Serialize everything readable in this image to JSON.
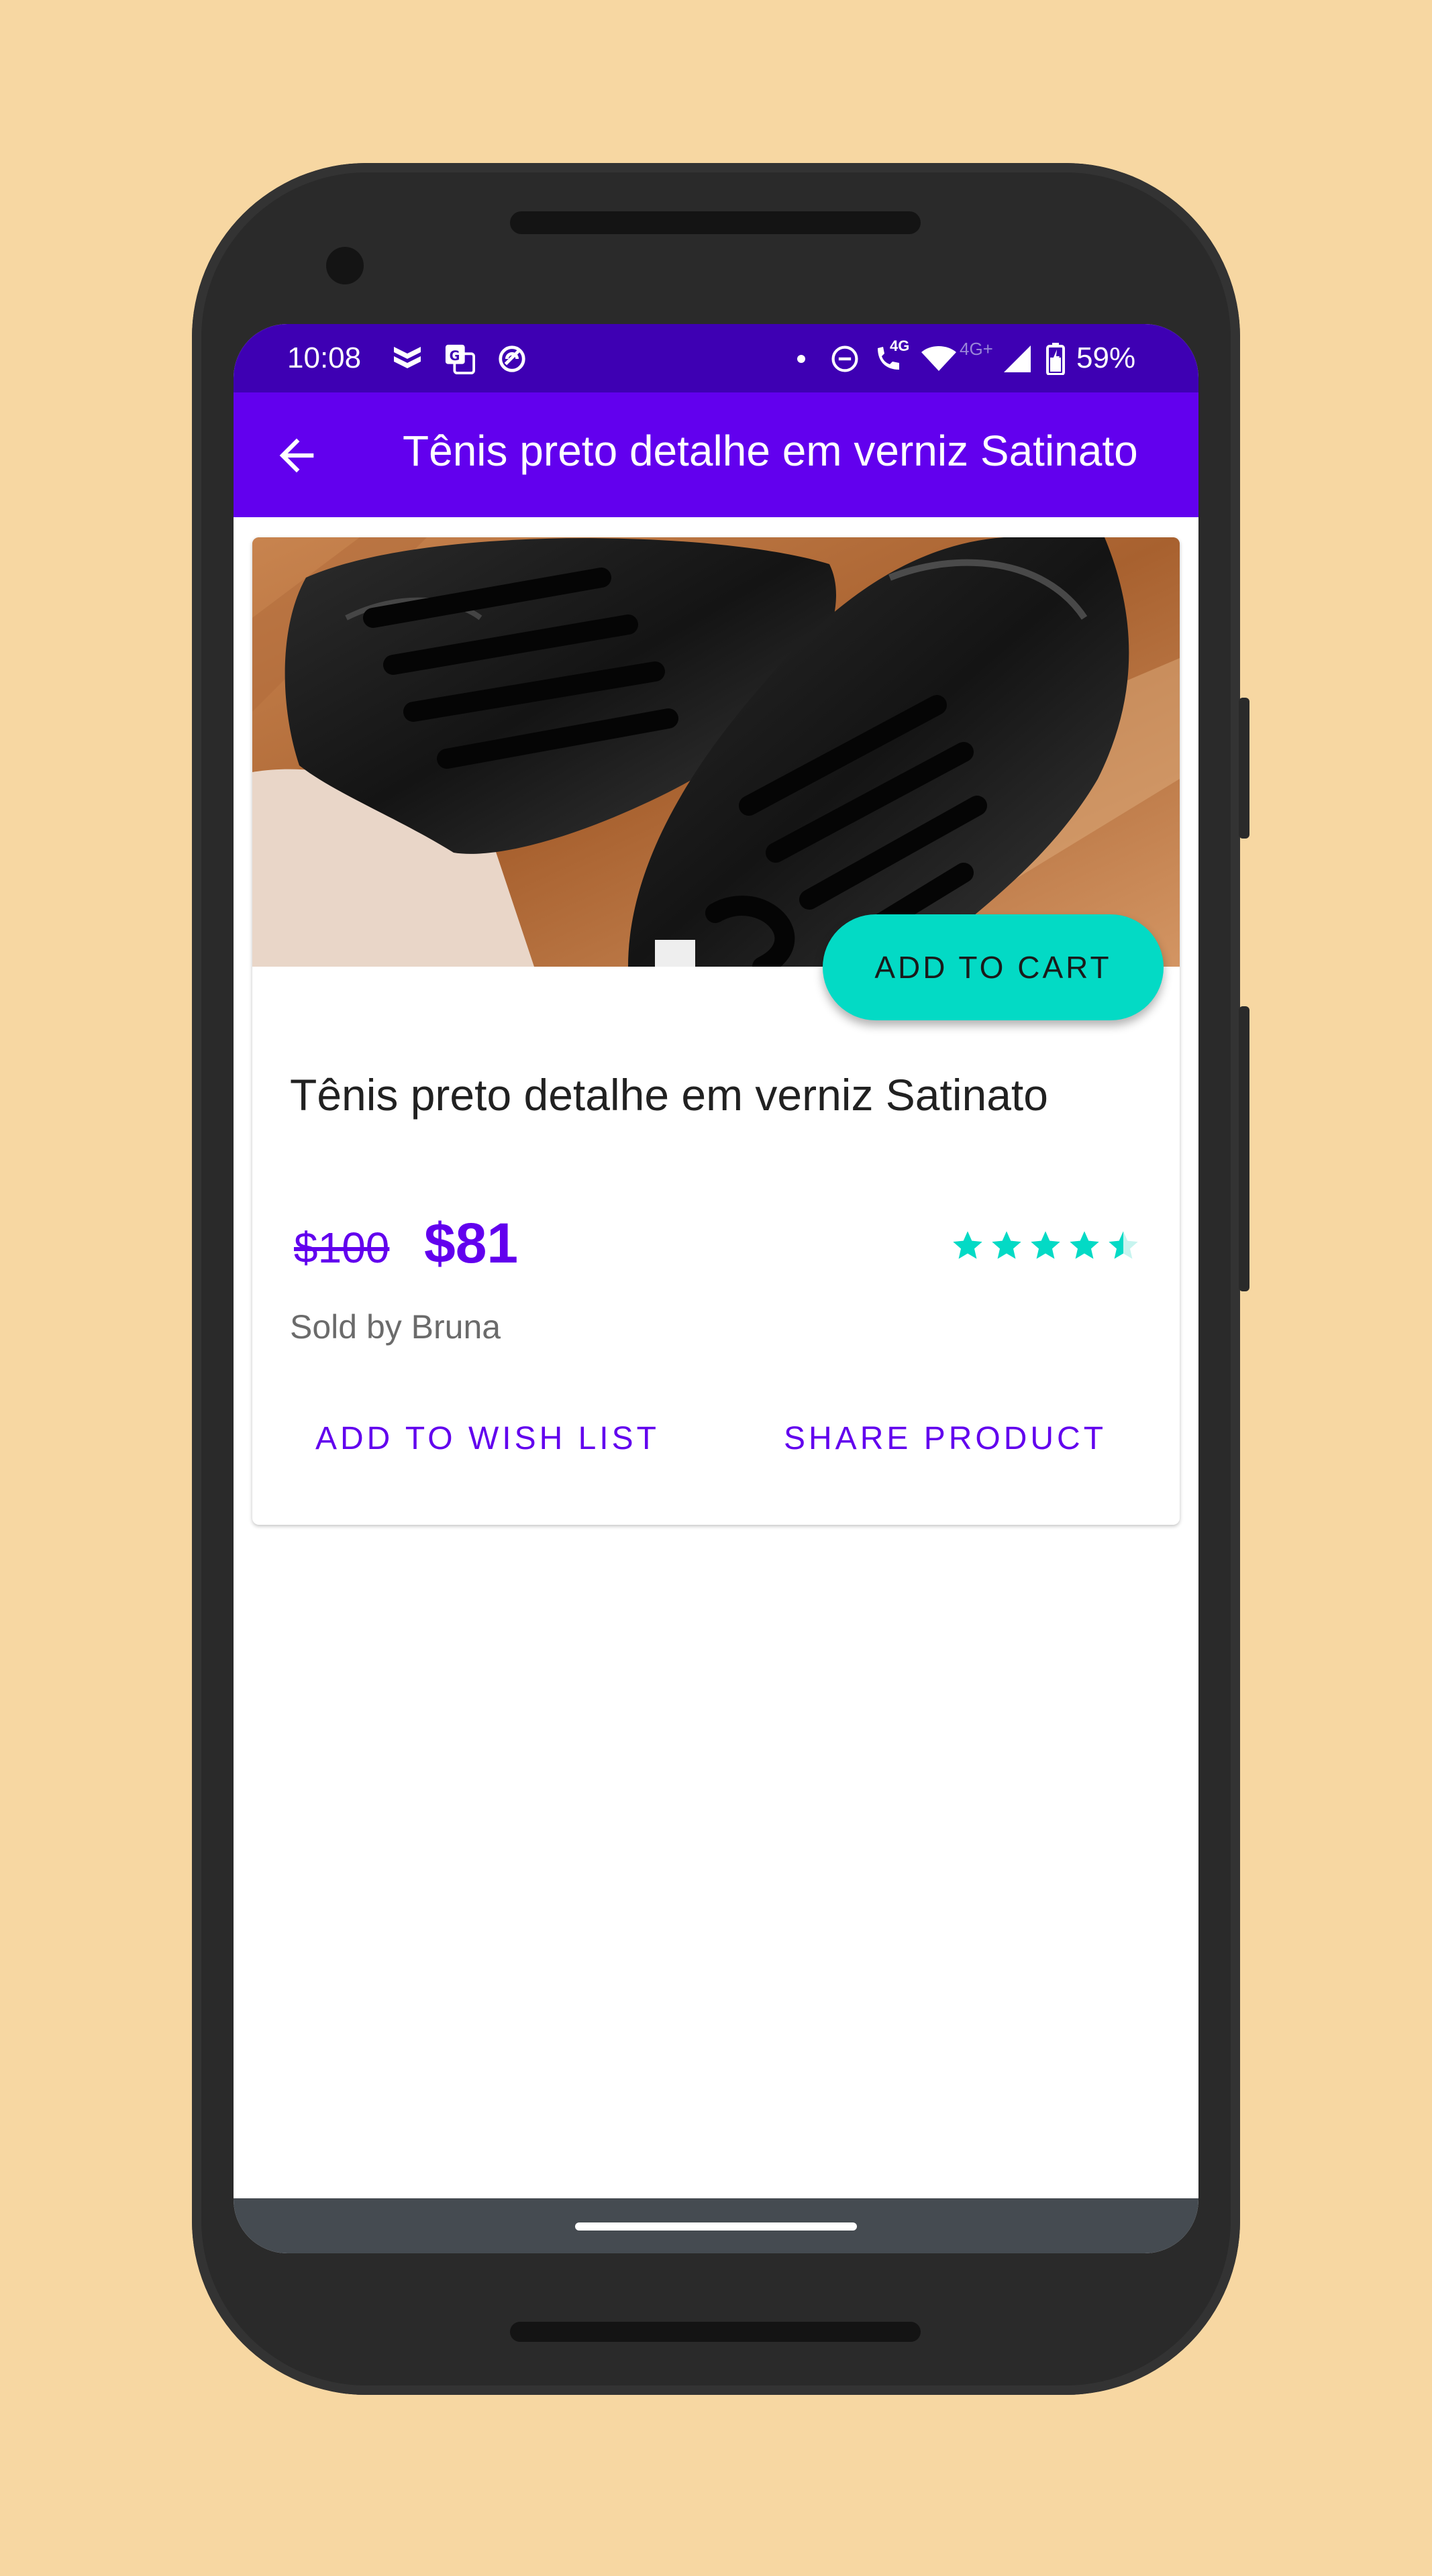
{
  "status_bar": {
    "time": "10:08",
    "signal_4g_label": "4G",
    "signal_4g_plus_label": "4G+",
    "battery": "59%",
    "icons": [
      "shield-app-icon",
      "translate-icon",
      "sync-icon",
      "dot-icon",
      "do-not-disturb-icon",
      "wifi-call-icon",
      "wifi-icon",
      "cell-signal-icon",
      "battery-icon"
    ]
  },
  "app_bar": {
    "title": "Tênis preto detalhe em verniz Satinato",
    "back_icon": "arrow-back-icon",
    "color": "#6200ee"
  },
  "product": {
    "title": "Tênis preto detalhe em verniz Satinato",
    "old_price": "$100",
    "new_price": "$81",
    "seller": "Sold by Bruna",
    "rating": 4.5,
    "rating_max": 5,
    "image": "black-sneakers-photo"
  },
  "actions": {
    "add_to_cart": "ADD TO CART",
    "add_to_wish_list": "ADD TO WISH LIST",
    "share_product": "SHARE PRODUCT"
  },
  "colors": {
    "primary": "#6200ee",
    "primary_dark": "#3e00b3",
    "accent": "#03dac5",
    "background": "#f7d7a2"
  }
}
